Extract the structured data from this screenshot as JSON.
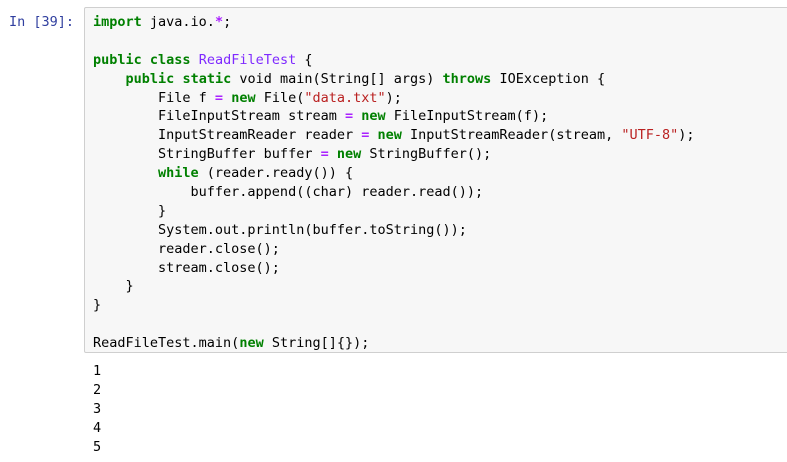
{
  "cell": {
    "prompt": "In [39]:",
    "code_lines": [
      [
        {
          "t": "import",
          "c": "kw"
        },
        {
          "t": " java.io."
        },
        {
          "t": "*",
          "c": "op"
        },
        {
          "t": ";"
        }
      ],
      [],
      [
        {
          "t": "public",
          "c": "kw"
        },
        {
          "t": " "
        },
        {
          "t": "class",
          "c": "kw"
        },
        {
          "t": " "
        },
        {
          "t": "ReadFileTest",
          "c": "def"
        },
        {
          "t": " {"
        }
      ],
      [
        {
          "t": "    "
        },
        {
          "t": "public",
          "c": "kw"
        },
        {
          "t": " "
        },
        {
          "t": "static",
          "c": "kw"
        },
        {
          "t": " void main(String[] args) "
        },
        {
          "t": "throws",
          "c": "kw"
        },
        {
          "t": " IOException {"
        }
      ],
      [
        {
          "t": "        File f "
        },
        {
          "t": "=",
          "c": "op"
        },
        {
          "t": " "
        },
        {
          "t": "new",
          "c": "kw"
        },
        {
          "t": " File("
        },
        {
          "t": "\"data.txt\"",
          "c": "str"
        },
        {
          "t": ");"
        }
      ],
      [
        {
          "t": "        FileInputStream stream "
        },
        {
          "t": "=",
          "c": "op"
        },
        {
          "t": " "
        },
        {
          "t": "new",
          "c": "kw"
        },
        {
          "t": " FileInputStream(f);"
        }
      ],
      [
        {
          "t": "        InputStreamReader reader "
        },
        {
          "t": "=",
          "c": "op"
        },
        {
          "t": " "
        },
        {
          "t": "new",
          "c": "kw"
        },
        {
          "t": " InputStreamReader(stream, "
        },
        {
          "t": "\"UTF-8\"",
          "c": "str"
        },
        {
          "t": ");"
        }
      ],
      [
        {
          "t": "        StringBuffer buffer "
        },
        {
          "t": "=",
          "c": "op"
        },
        {
          "t": " "
        },
        {
          "t": "new",
          "c": "kw"
        },
        {
          "t": " StringBuffer();"
        }
      ],
      [
        {
          "t": "        "
        },
        {
          "t": "while",
          "c": "kw"
        },
        {
          "t": " (reader.ready()) {"
        }
      ],
      [
        {
          "t": "            buffer.append((char) reader.read());"
        }
      ],
      [
        {
          "t": "        }"
        }
      ],
      [
        {
          "t": "        System.out.println(buffer.toString());"
        }
      ],
      [
        {
          "t": "        reader.close();"
        }
      ],
      [
        {
          "t": "        stream.close();"
        }
      ],
      [
        {
          "t": "    }"
        }
      ],
      [
        {
          "t": "}"
        }
      ],
      [],
      [
        {
          "t": "ReadFileTest.main("
        },
        {
          "t": "new",
          "c": "kw"
        },
        {
          "t": " String[]{});"
        }
      ]
    ]
  },
  "output_lines": [
    "1",
    "2",
    "3",
    "4",
    "5"
  ],
  "colors": {
    "prompt": "#303f9f",
    "keyword": "#008000",
    "operator": "#aa22ff",
    "string": "#ba2121",
    "class_name": "#7f2aff",
    "cell_background": "#f7f7f7",
    "cell_border": "#cfcfcf"
  }
}
